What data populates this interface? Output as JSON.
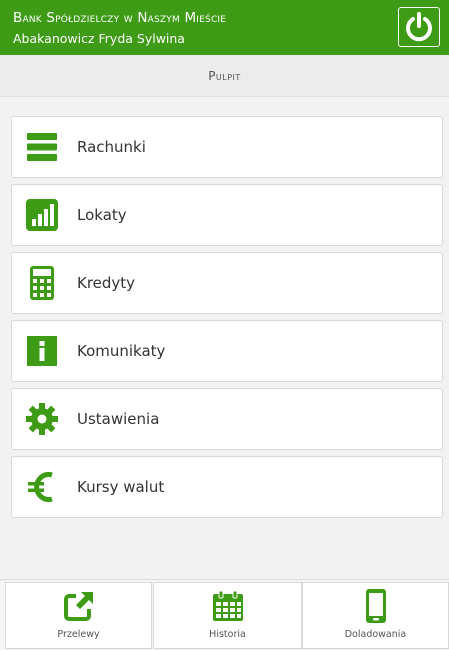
{
  "header": {
    "bank_name": "Bank Spółdzielczy w Naszym Mieście",
    "user_name": "Abakanowicz Fryda Sylwina",
    "accent_color": "#3e9b16",
    "logout_icon": "power-icon"
  },
  "subheader": {
    "title": "Pulpit"
  },
  "menu": {
    "items": [
      {
        "label": "Rachunki",
        "icon": "list-icon"
      },
      {
        "label": "Lokaty",
        "icon": "bar-chart-icon"
      },
      {
        "label": "Kredyty",
        "icon": "calculator-icon"
      },
      {
        "label": "Komunikaty",
        "icon": "info-icon"
      },
      {
        "label": "Ustawienia",
        "icon": "gear-icon"
      },
      {
        "label": "Kursy walut",
        "icon": "euro-icon"
      }
    ]
  },
  "bottom_nav": {
    "items": [
      {
        "label": "Przelewy",
        "icon": "external-link-icon"
      },
      {
        "label": "Historia",
        "icon": "calendar-icon"
      },
      {
        "label": "Doladowania",
        "icon": "mobile-phone-icon"
      }
    ]
  }
}
